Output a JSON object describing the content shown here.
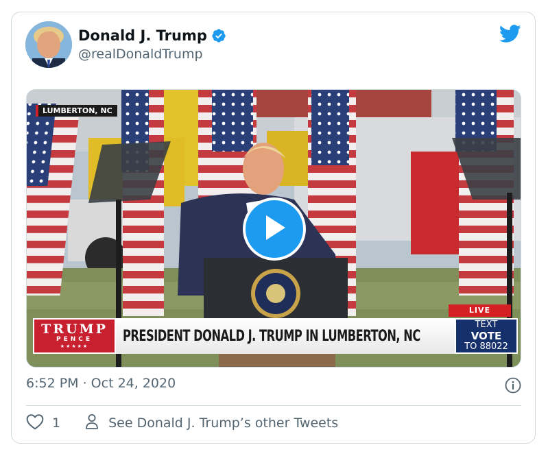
{
  "author": {
    "display_name": "Donald J. Trump",
    "handle": "@realDonaldTrump",
    "verified": true
  },
  "media": {
    "location_tag": "LUMBERTON, NC",
    "live_label": "LIVE",
    "banner_logo_line1": "TRUMP",
    "banner_logo_line2": "PENCE",
    "banner_logo_stars": "★★★★★",
    "banner_text": "PRESIDENT DONALD J. TRUMP IN LUMBERTON, NC",
    "vote_line1": "TEXT",
    "vote_line2": "VOTE",
    "vote_line3": "TO 88022"
  },
  "tweet": {
    "timestamp": "6:52 PM · Oct 24, 2020"
  },
  "actions": {
    "like_count": "1",
    "other_tweets_label": "See Donald J. Trump’s other Tweets"
  },
  "colors": {
    "accent": "#1d9bf0",
    "text_primary": "#0f1419",
    "text_secondary": "#536471",
    "border": "#cfd9de"
  },
  "icons": [
    "twitter-bird-icon",
    "verified-badge-icon",
    "play-icon",
    "info-icon",
    "heart-icon",
    "person-icon"
  ]
}
